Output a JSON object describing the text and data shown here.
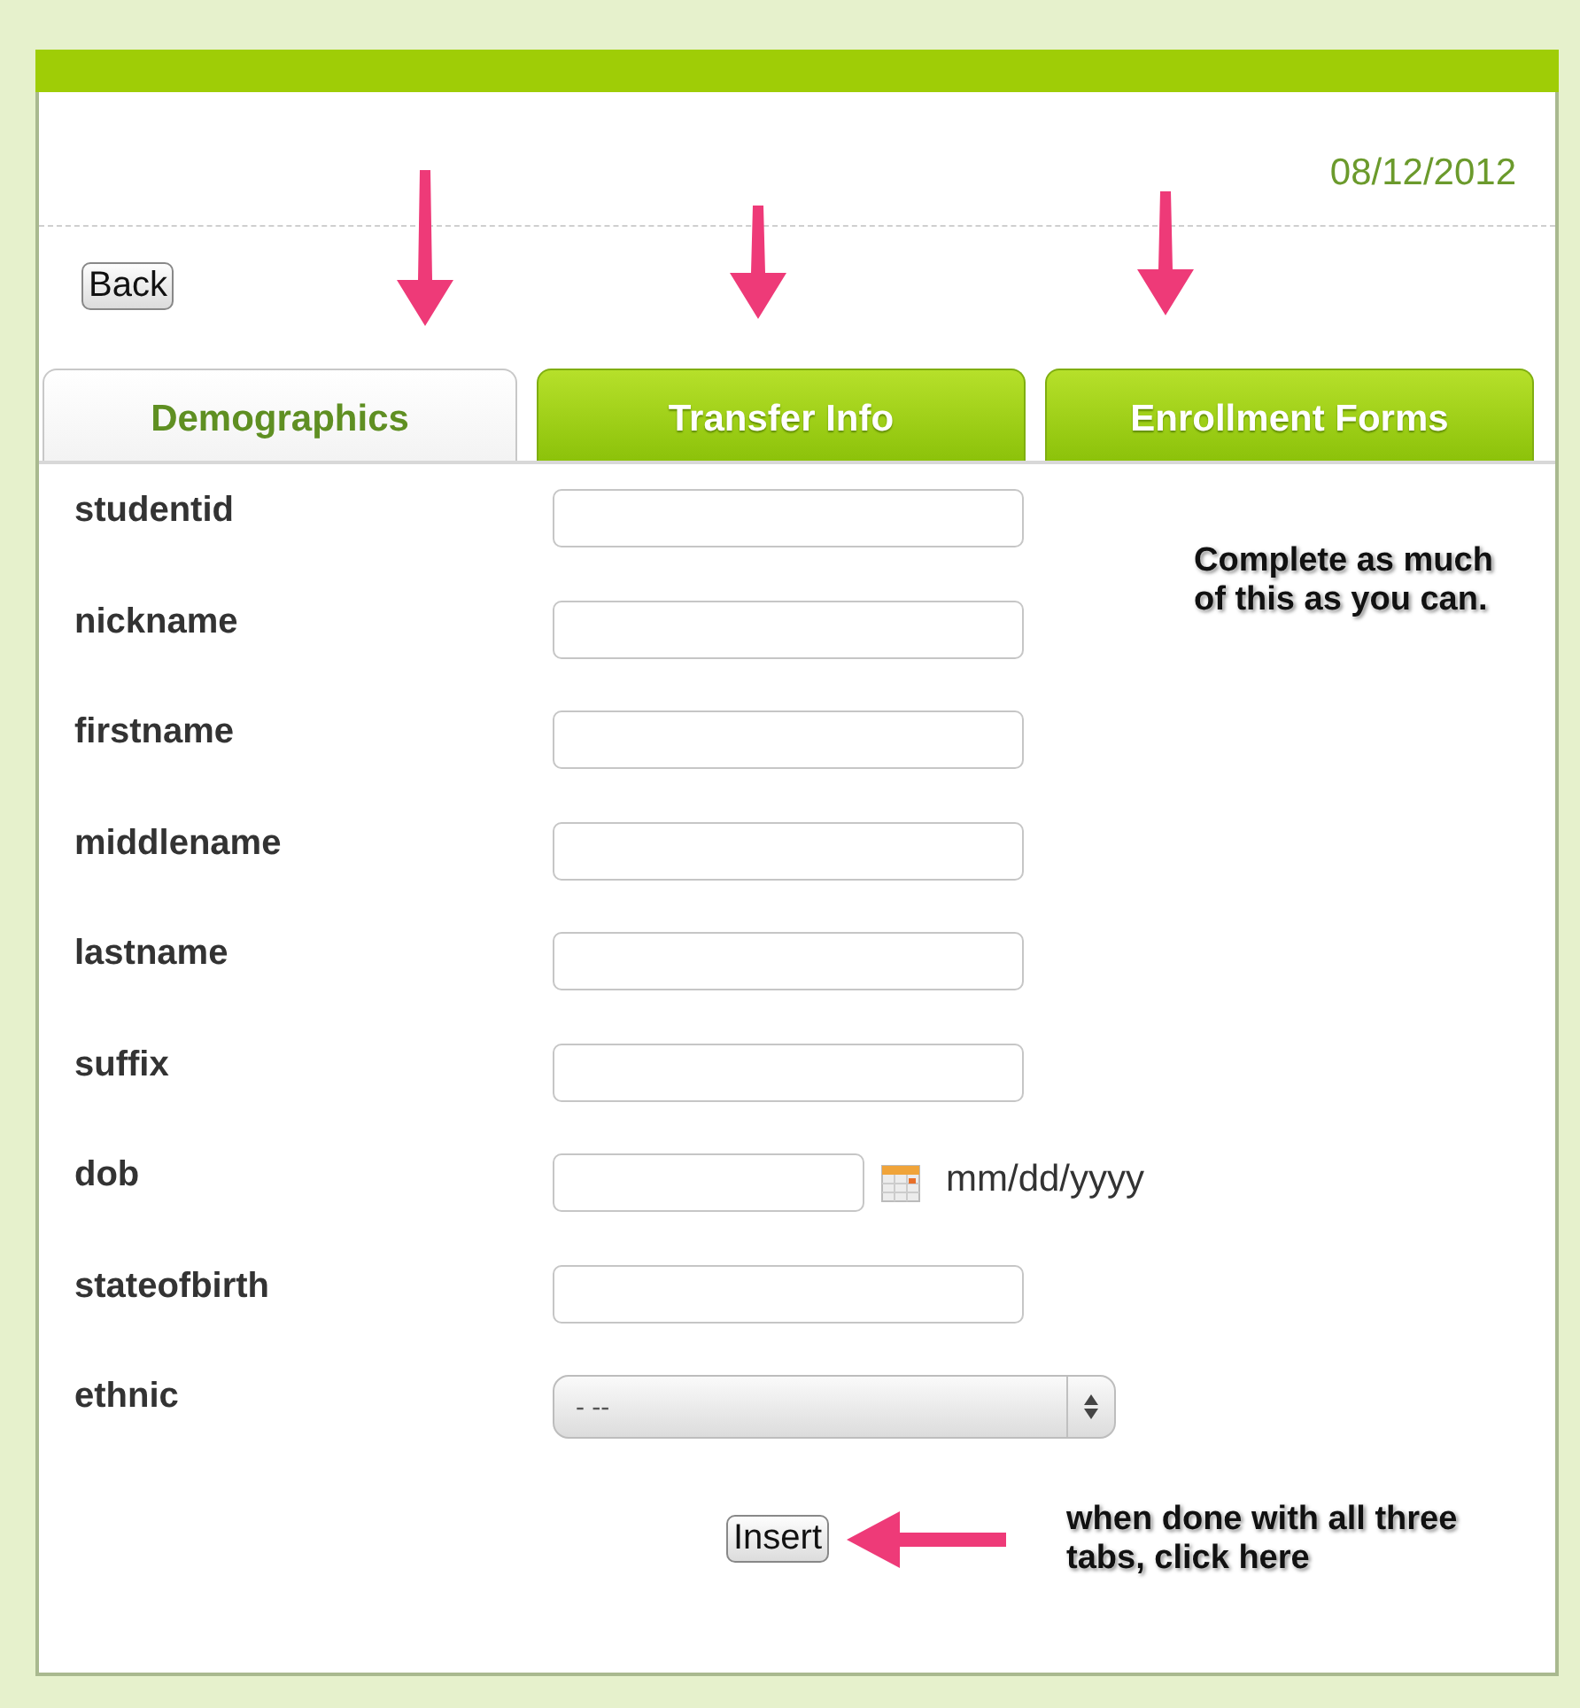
{
  "date": "08/12/2012",
  "back_button": "Back",
  "tabs": [
    {
      "label": "Demographics",
      "selected": true
    },
    {
      "label": "Transfer Info",
      "selected": false
    },
    {
      "label": "Enrollment Forms",
      "selected": false
    }
  ],
  "fields": [
    {
      "label": "studentid",
      "kind": "text"
    },
    {
      "label": "nickname",
      "kind": "text"
    },
    {
      "label": "firstname",
      "kind": "text"
    },
    {
      "label": "middlename",
      "kind": "text"
    },
    {
      "label": "lastname",
      "kind": "text"
    },
    {
      "label": "suffix",
      "kind": "text"
    },
    {
      "label": "dob",
      "kind": "date",
      "hint": "mm/dd/yyyy"
    },
    {
      "label": "stateofbirth",
      "kind": "text"
    },
    {
      "label": "ethnic",
      "kind": "select",
      "value": "- --"
    }
  ],
  "form_note": "Complete as much of this as you can.",
  "insert_button": "Insert",
  "insert_note": "when done with all three tabs, click here"
}
